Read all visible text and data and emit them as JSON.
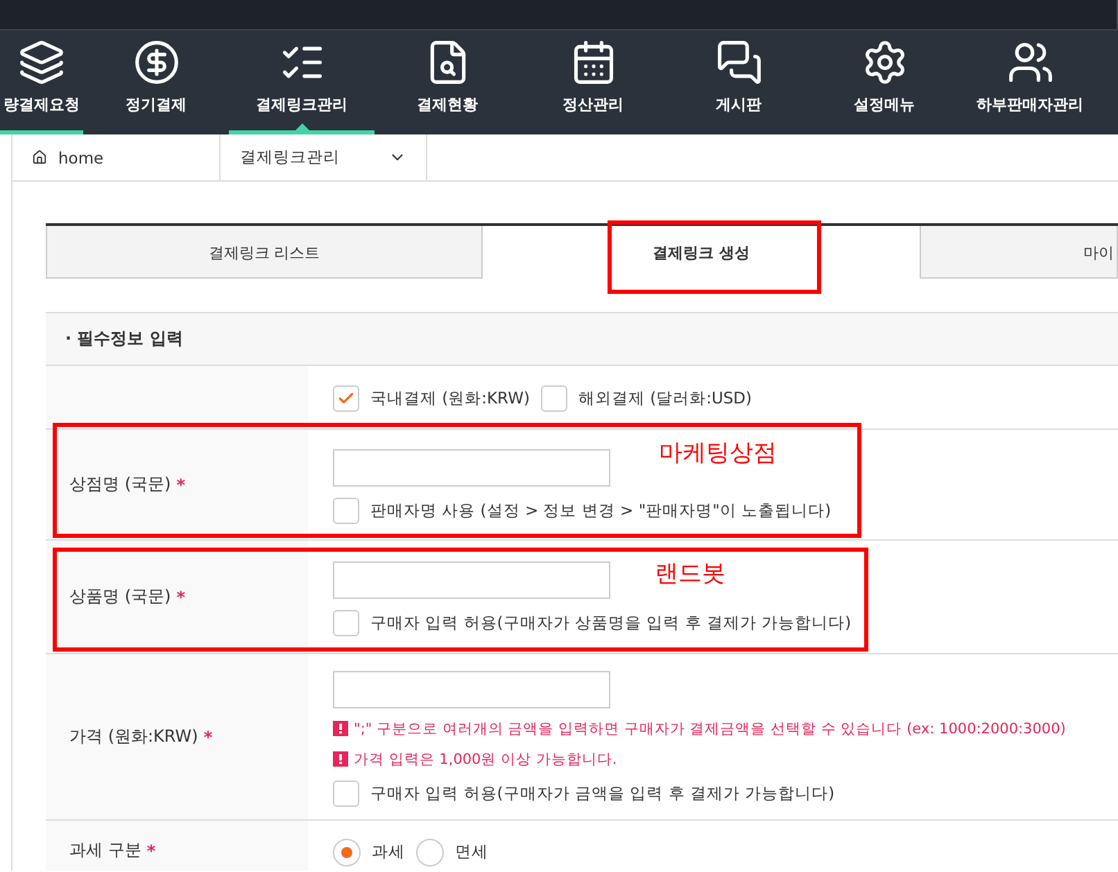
{
  "nav": {
    "items": [
      {
        "label": "량결제요청",
        "selected": false,
        "underline": true
      },
      {
        "label": "정기결제",
        "selected": false,
        "underline": false
      },
      {
        "label": "결제링크관리",
        "selected": true,
        "underline": true
      },
      {
        "label": "결제현황",
        "selected": false,
        "underline": false
      },
      {
        "label": "정산관리",
        "selected": false,
        "underline": false
      },
      {
        "label": "게시판",
        "selected": false,
        "underline": false
      },
      {
        "label": "설정메뉴",
        "selected": false,
        "underline": false
      },
      {
        "label": "하부판매자관리",
        "selected": false,
        "underline": false
      }
    ]
  },
  "breadcrumb": {
    "home": "home",
    "current": "결제링크관리"
  },
  "tabs": [
    {
      "label": "결제링크 리스트",
      "selected": false
    },
    {
      "label": "결제링크 생성",
      "selected": true
    },
    {
      "label": "마이",
      "selected": false
    }
  ],
  "section_title": "· 필수정보 입력",
  "payment_types": [
    {
      "label": "국내결제 (원화:KRW)",
      "checked": true
    },
    {
      "label": "해외결제 (달러화:USD)",
      "checked": false
    }
  ],
  "shop_name": {
    "label": "상점명 (국문)",
    "required": "*",
    "option": {
      "label": "판매자명 사용 (설정 > 정보 변경 > \"판매자명\"이 노출됩니다)",
      "checked": false
    }
  },
  "product_name": {
    "label": "상품명 (국문)",
    "required": "*",
    "option": {
      "label": "구매자 입력 허용(구매자가 상품명을 입력 후 결제가 가능합니다)",
      "checked": false
    }
  },
  "price": {
    "label": "가격 (원화:KRW)",
    "required": "*",
    "notes": [
      "\";\" 구분으로 여러개의 금액을 입력하면 구매자가 결제금액을 선택할 수 있습니다 (ex: 1000:2000:3000)",
      "가격 입력은 1,000원 이상 가능합니다."
    ],
    "option": {
      "label": "구매자 입력 허용(구매자가 금액을 입력 후 결제가 가능합니다)",
      "checked": false
    }
  },
  "tax": {
    "label": "과세 구분",
    "required": "*",
    "options": [
      {
        "label": "과세",
        "selected": true
      },
      {
        "label": "면세",
        "selected": false
      }
    ]
  },
  "annotations": {
    "shop_name": "마케팅상점",
    "product_name": "랜드봇"
  }
}
